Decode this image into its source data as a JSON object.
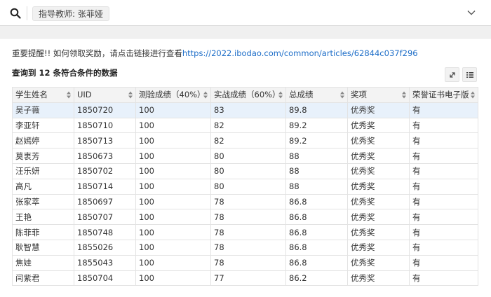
{
  "header": {
    "filter_tag": "指导教师: 张菲娅"
  },
  "notice": {
    "text": "重要提醒!! 如何领取奖励，请点击链接进行查看",
    "link": "https://2022.ibodao.com/common/articles/62844c037f296"
  },
  "result": {
    "prefix": "查询到 ",
    "count": "12",
    "suffix": " 条符合条件的数据"
  },
  "table": {
    "columns": [
      "学生姓名",
      "UID",
      "测验成绩（40%）",
      "实战成绩（60%）",
      "总成绩",
      "奖项",
      "荣誉证书电子版"
    ],
    "rows": [
      [
        "吴子薇",
        "1850720",
        "100",
        "83",
        "89.8",
        "优秀奖",
        "有"
      ],
      [
        "李亚轩",
        "1850710",
        "100",
        "82",
        "89.2",
        "优秀奖",
        "有"
      ],
      [
        "赵嫣婷",
        "1850713",
        "100",
        "82",
        "89.2",
        "优秀奖",
        "有"
      ],
      [
        "莫衷芳",
        "1850673",
        "100",
        "80",
        "88",
        "优秀奖",
        "有"
      ],
      [
        "汪乐妍",
        "1850702",
        "100",
        "80",
        "88",
        "优秀奖",
        "有"
      ],
      [
        "高凡",
        "1850714",
        "100",
        "80",
        "88",
        "优秀奖",
        "有"
      ],
      [
        "张家萃",
        "1850697",
        "100",
        "78",
        "86.8",
        "优秀奖",
        "有"
      ],
      [
        "王艳",
        "1850707",
        "100",
        "78",
        "86.8",
        "优秀奖",
        "有"
      ],
      [
        "陈菲菲",
        "1850748",
        "100",
        "78",
        "86.8",
        "优秀奖",
        "有"
      ],
      [
        "耿智慧",
        "1855026",
        "100",
        "78",
        "86.8",
        "优秀奖",
        "有"
      ],
      [
        "焦娃",
        "1855043",
        "100",
        "78",
        "86.8",
        "优秀奖",
        "有"
      ],
      [
        "闫紫君",
        "1850704",
        "100",
        "77",
        "86.2",
        "优秀奖",
        "有"
      ]
    ]
  },
  "icons": {
    "search": "search-icon",
    "chevron": "chevron-down-icon",
    "expand": "expand-icon",
    "columns": "column-list-icon",
    "sort": "sort-icon"
  },
  "colors": {
    "link": "#1e6ec8",
    "selected_row": "#e8f1fb"
  }
}
